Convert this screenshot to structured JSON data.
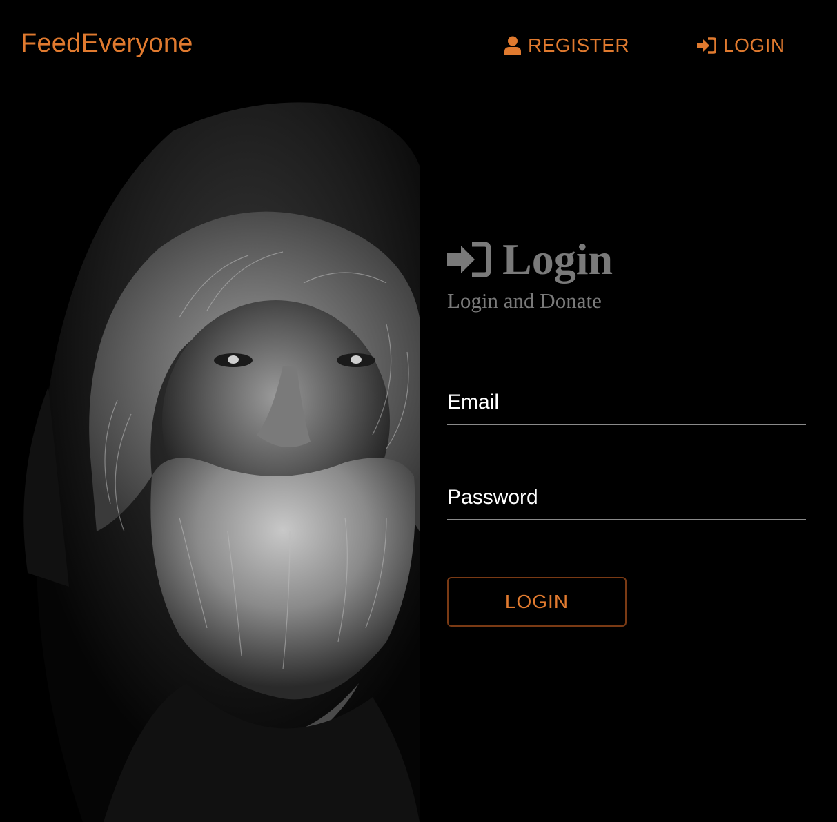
{
  "navbar": {
    "brand": "FeedEveryone",
    "register_label": "REGISTER",
    "login_label": "LOGIN",
    "register_icon": "user-icon",
    "login_icon": "sign-in-icon"
  },
  "login": {
    "title": "Login",
    "title_icon": "sign-in-icon",
    "subtitle": "Login and Donate",
    "email_label": "Email",
    "email_value": "",
    "password_label": "Password",
    "password_value": "",
    "button_label": "LOGIN"
  },
  "colors": {
    "accent": "#e07a2f",
    "background": "#000000",
    "heading": "#7a7a7a",
    "button_border": "#7a3a14"
  }
}
